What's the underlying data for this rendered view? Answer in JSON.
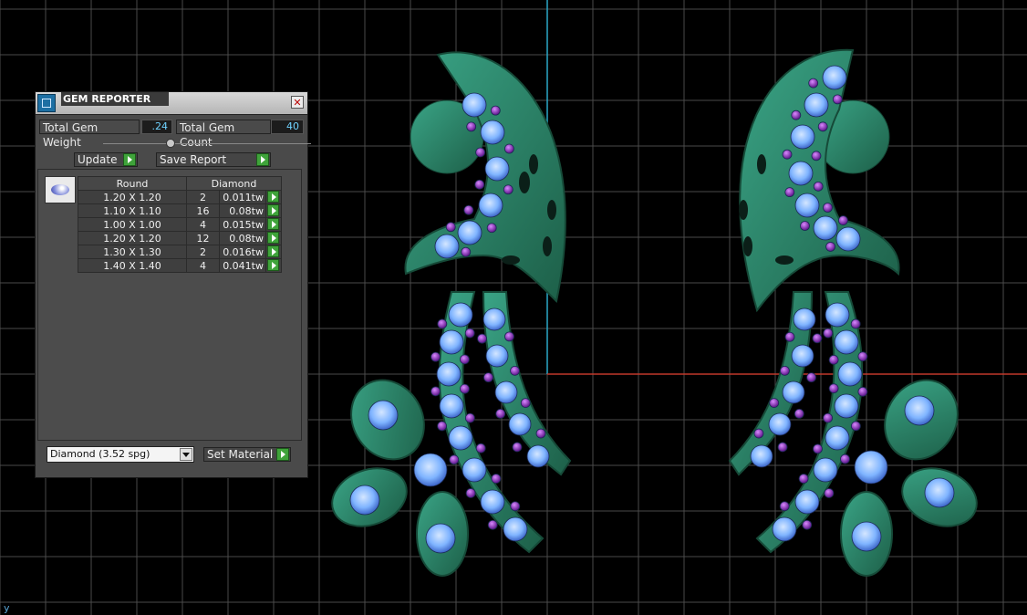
{
  "panel": {
    "title": "GEM REPORTER",
    "close_glyph": "✕",
    "total_weight_label": "Total Gem Weight",
    "total_weight_value": ".24",
    "total_count_label": "Total Gem Count",
    "total_count_value": "40",
    "update_label": "Update",
    "save_report_label": "Save Report",
    "table": {
      "headers": [
        "Round",
        "Diamond"
      ],
      "rows": [
        {
          "size": "1.20 X 1.20",
          "count": "2",
          "weight": "0.011tw"
        },
        {
          "size": "1.10 X 1.10",
          "count": "16",
          "weight": "0.08tw"
        },
        {
          "size": "1.00 X 1.00",
          "count": "4",
          "weight": "0.015tw"
        },
        {
          "size": "1.20 X 1.20",
          "count": "12",
          "weight": "0.08tw"
        },
        {
          "size": "1.30 X 1.30",
          "count": "2",
          "weight": "0.016tw"
        },
        {
          "size": "1.40 X 1.40",
          "count": "4",
          "weight": "0.041tw"
        }
      ]
    },
    "material_select": "Diamond    (3.52 spg)",
    "set_material_label": "Set Material"
  },
  "viewport": {
    "axis_label": "y",
    "colors": {
      "background": "#000000",
      "grid": "#4a4a4a",
      "axis_x": "#c0392b",
      "axis_y": "#2aa8c8",
      "metal": "#2a8a6a",
      "diamond": "#7fb4ff",
      "amethyst": "#8a2fb0"
    }
  },
  "icons": [
    "gem-reporter-app-icon",
    "close-icon",
    "go-arrow-icon",
    "gem-shape-thumbnail",
    "dropdown-arrow-icon"
  ]
}
